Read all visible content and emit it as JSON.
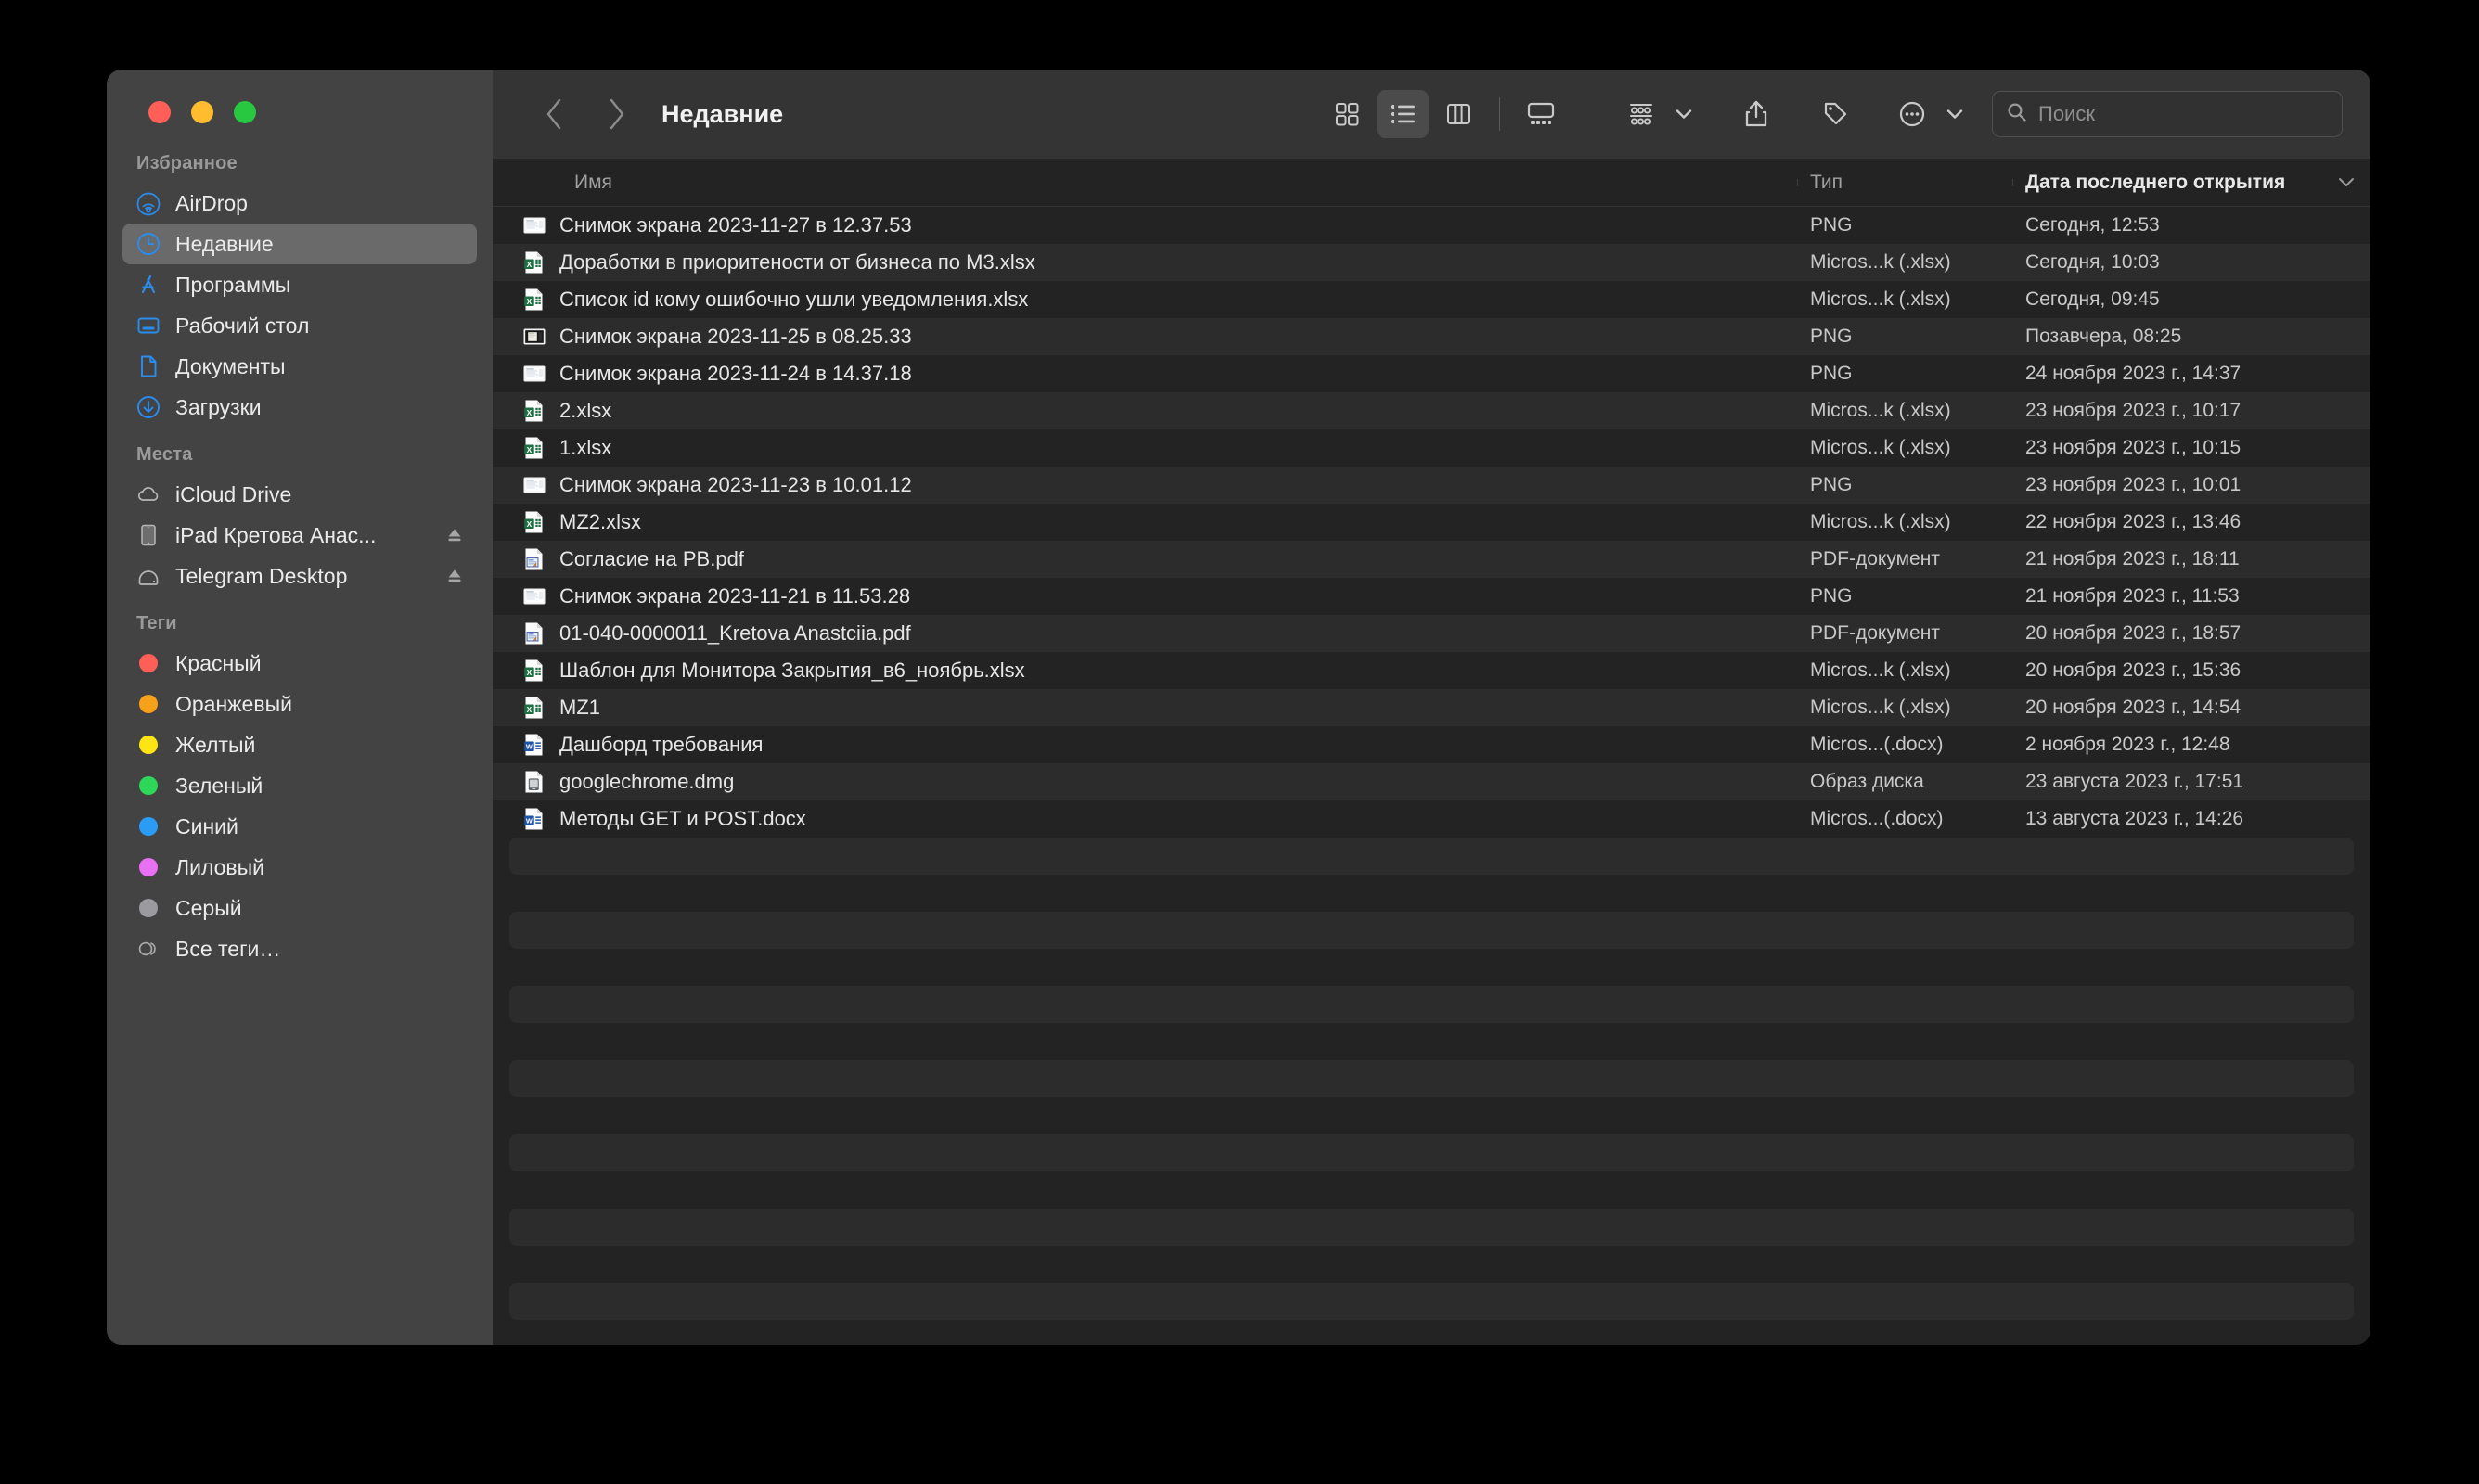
{
  "window": {
    "traffic_lights": [
      {
        "name": "close",
        "color": "#ff5f57"
      },
      {
        "name": "minimize",
        "color": "#febc2e"
      },
      {
        "name": "zoom",
        "color": "#28c840"
      }
    ]
  },
  "toolbar": {
    "back_label": "‹",
    "forward_label": "›",
    "title": "Недавние",
    "views": [
      {
        "name": "icon-view",
        "active": false
      },
      {
        "name": "list-view",
        "active": true
      },
      {
        "name": "column-view",
        "active": false
      },
      {
        "name": "gallery-view",
        "active": false
      }
    ],
    "group_button": "group-by",
    "share_button": "share",
    "tag_button": "tags",
    "more_button": "more-actions"
  },
  "search": {
    "placeholder": "Поиск",
    "value": ""
  },
  "sidebar": {
    "sections": [
      {
        "title": "Избранное",
        "items": [
          {
            "label": "AirDrop",
            "icon": "airdrop-icon",
            "selected": false,
            "eject": false
          },
          {
            "label": "Недавние",
            "icon": "clock-icon",
            "selected": true,
            "eject": false
          },
          {
            "label": "Программы",
            "icon": "applications-icon",
            "selected": false,
            "eject": false
          },
          {
            "label": "Рабочий стол",
            "icon": "desktop-icon",
            "selected": false,
            "eject": false
          },
          {
            "label": "Документы",
            "icon": "document-icon",
            "selected": false,
            "eject": false
          },
          {
            "label": "Загрузки",
            "icon": "downloads-icon",
            "selected": false,
            "eject": false
          }
        ]
      },
      {
        "title": "Места",
        "items": [
          {
            "label": "iCloud Drive",
            "icon": "cloud-icon",
            "selected": false,
            "eject": false
          },
          {
            "label": "iPad Кретова Анас...",
            "icon": "ipad-icon",
            "selected": false,
            "eject": true
          },
          {
            "label": "Telegram Desktop",
            "icon": "disk-icon",
            "selected": false,
            "eject": true
          }
        ]
      },
      {
        "title": "Теги",
        "items": [
          {
            "label": "Красный",
            "icon": "tag-dot",
            "color": "#ff5f56",
            "selected": false,
            "eject": false
          },
          {
            "label": "Оранжевый",
            "icon": "tag-dot",
            "color": "#f7a019",
            "selected": false,
            "eject": false
          },
          {
            "label": "Желтый",
            "icon": "tag-dot",
            "color": "#ffe414",
            "selected": false,
            "eject": false
          },
          {
            "label": "Зеленый",
            "icon": "tag-dot",
            "color": "#2ed757",
            "selected": false,
            "eject": false
          },
          {
            "label": "Синий",
            "icon": "tag-dot",
            "color": "#2b9cf5",
            "selected": false,
            "eject": false
          },
          {
            "label": "Лиловый",
            "icon": "tag-dot",
            "color": "#e770f3",
            "selected": false,
            "eject": false
          },
          {
            "label": "Серый",
            "icon": "tag-dot",
            "color": "#9b9b9f",
            "selected": false,
            "eject": false
          },
          {
            "label": "Все теги…",
            "icon": "all-tags-icon",
            "selected": false,
            "eject": false
          }
        ]
      }
    ]
  },
  "columns": {
    "name": "Имя",
    "type": "Тип",
    "date": "Дата последнего открытия",
    "sort_arrow": "⌄",
    "sorted_by": "date"
  },
  "files": [
    {
      "name": "Снимок экрана 2023-11-27 в 12.37.53",
      "type": "PNG",
      "date": "Сегодня, 12:53",
      "icon": "screenshot-icon"
    },
    {
      "name": "Доработки в приоритености от бизнеса по М3.xlsx",
      "type": "Micros...k (.xlsx)",
      "date": "Сегодня, 10:03",
      "icon": "excel-icon"
    },
    {
      "name": "Список id кому ошибочно ушли уведомления.xlsx",
      "type": "Micros...k (.xlsx)",
      "date": "Сегодня, 09:45",
      "icon": "excel-icon"
    },
    {
      "name": "Снимок экрана 2023-11-25 в 08.25.33",
      "type": "PNG",
      "date": "Позавчера, 08:25",
      "icon": "screenshot-dark-icon"
    },
    {
      "name": "Снимок экрана 2023-11-24 в 14.37.18",
      "type": "PNG",
      "date": "24 ноября 2023 г., 14:37",
      "icon": "screenshot-icon"
    },
    {
      "name": "2.xlsx",
      "type": "Micros...k (.xlsx)",
      "date": "23 ноября 2023 г., 10:17",
      "icon": "excel-icon"
    },
    {
      "name": "1.xlsx",
      "type": "Micros...k (.xlsx)",
      "date": "23 ноября 2023 г., 10:15",
      "icon": "excel-icon"
    },
    {
      "name": "Снимок экрана 2023-11-23 в 10.01.12",
      "type": "PNG",
      "date": "23 ноября 2023 г., 10:01",
      "icon": "screenshot-icon"
    },
    {
      "name": "MZ2.xlsx",
      "type": "Micros...k (.xlsx)",
      "date": "22 ноября 2023 г., 13:46",
      "icon": "excel-icon"
    },
    {
      "name": "Согласие на PB.pdf",
      "type": "PDF-документ",
      "date": "21 ноября 2023 г., 18:11",
      "icon": "pdf-icon"
    },
    {
      "name": "Снимок экрана 2023-11-21 в 11.53.28",
      "type": "PNG",
      "date": "21 ноября 2023 г., 11:53",
      "icon": "screenshot-icon"
    },
    {
      "name": "01-040-0000011_Kretova Anastciia.pdf",
      "type": "PDF-документ",
      "date": "20 ноября 2023 г., 18:57",
      "icon": "pdf-icon"
    },
    {
      "name": "Шаблон для Монитора Закрытия_в6_ноябрь.xlsx",
      "type": "Micros...k (.xlsx)",
      "date": "20 ноября 2023 г., 15:36",
      "icon": "excel-icon"
    },
    {
      "name": "MZ1",
      "type": "Micros...k (.xlsx)",
      "date": "20 ноября 2023 г., 14:54",
      "icon": "excel-icon"
    },
    {
      "name": "Дашборд требования",
      "type": "Micros...(.docx)",
      "date": "2 ноября 2023 г., 12:48",
      "icon": "word-icon"
    },
    {
      "name": "googlechrome.dmg",
      "type": "Образ диска",
      "date": "23 августа 2023 г., 17:51",
      "icon": "dmg-icon"
    },
    {
      "name": "Методы GET и POST.docx",
      "type": "Micros...(.docx)",
      "date": "13 августа 2023 г., 14:26",
      "icon": "word-icon"
    }
  ],
  "filler_rows": 14
}
